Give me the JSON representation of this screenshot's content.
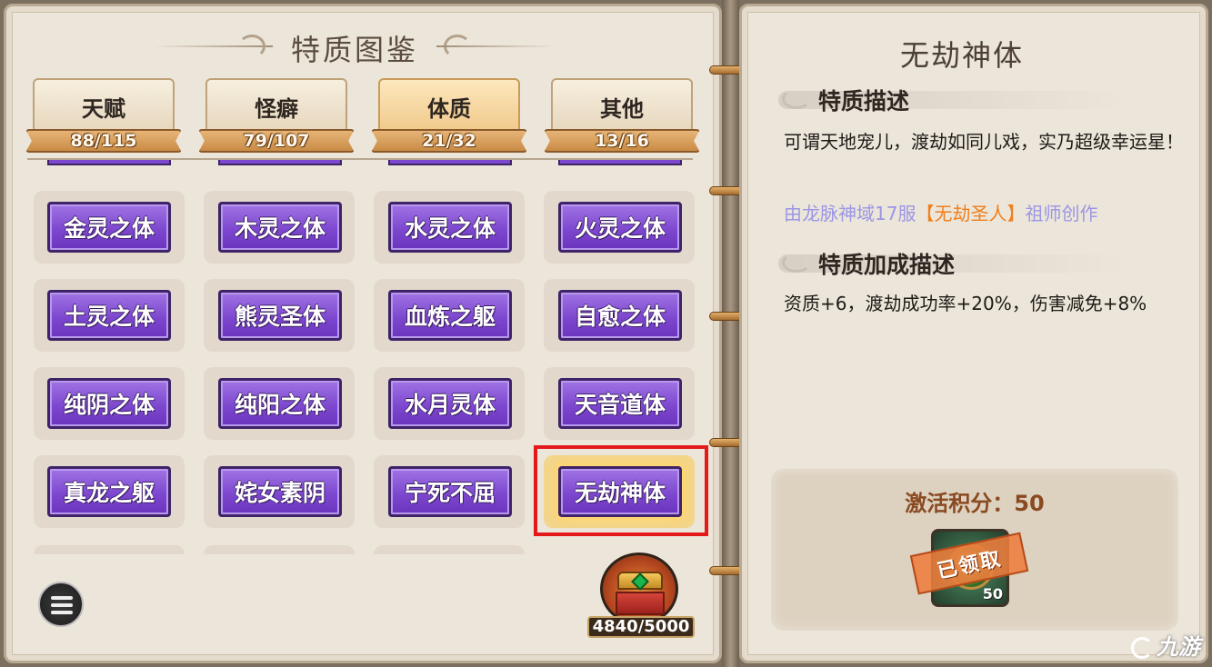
{
  "book": {
    "title": "特质图鉴"
  },
  "tabs": [
    {
      "label": "天赋",
      "count": "88/115",
      "active": false
    },
    {
      "label": "怪癖",
      "count": "79/107",
      "active": false
    },
    {
      "label": "体质",
      "count": "21/32",
      "active": true
    },
    {
      "label": "其他",
      "count": "13/16",
      "active": false
    }
  ],
  "traits": [
    [
      "金灵之体",
      "木灵之体",
      "水灵之体",
      "火灵之体"
    ],
    [
      "土灵之体",
      "熊灵圣体",
      "血炼之躯",
      "自愈之体"
    ],
    [
      "纯阴之体",
      "纯阳之体",
      "水月灵体",
      "天音道体"
    ],
    [
      "真龙之躯",
      "姹女素阴",
      "宁死不屈",
      "无劫神体"
    ]
  ],
  "selected_trait": "无劫神体",
  "chest": {
    "progress": "4840/5000",
    "value": 4840,
    "max": 5000
  },
  "detail": {
    "title": "无劫神体",
    "desc_heading": "特质描述",
    "description": "可谓天地宠儿，渡劫如同儿戏，实乃超级幸运星！",
    "origin_prefix": "由龙脉神域17服",
    "origin_name": "【无劫圣人】",
    "origin_suffix": "祖师创作",
    "bonus_heading": "特质加成描述",
    "bonus": "资质+6，渡劫成功率+20%，伤害减免+8%",
    "points_label": "激活积分：50",
    "reward_qty": "50",
    "claimed_label": "已领取"
  },
  "watermark": "九游",
  "colors": {
    "trait_purple": "#7d48cf",
    "highlight_red": "#e3191a",
    "origin_blue": "#9a96e6",
    "origin_orange": "#f07f1c"
  },
  "icons": [
    "menu-list-icon",
    "treasure-chest-icon",
    "reward-orb-icon"
  ]
}
